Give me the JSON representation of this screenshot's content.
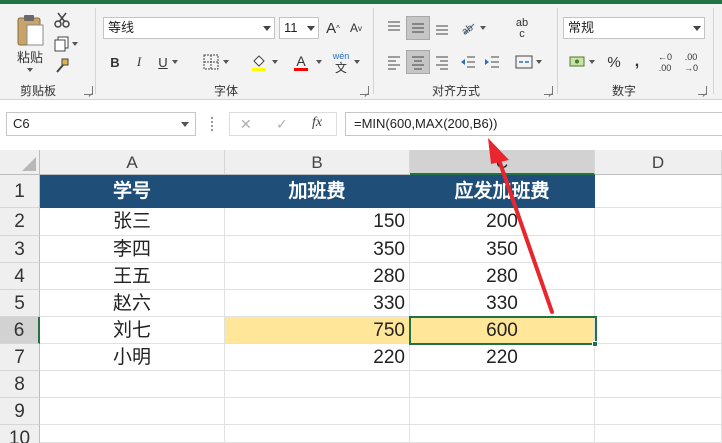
{
  "ribbon": {
    "clipboard": {
      "paste_label": "粘贴",
      "group_label": "剪贴板"
    },
    "font": {
      "font_name": "等线",
      "font_size": "11",
      "bold": "B",
      "italic": "I",
      "underline": "U",
      "grow": "A",
      "shrink": "A",
      "font_color": "A",
      "phonetic": "wén",
      "phonetic_sub": "文",
      "group_label": "字体"
    },
    "alignment": {
      "wrap": "ab",
      "wrap_sub": "c",
      "group_label": "对齐方式"
    },
    "number": {
      "format": "常规",
      "percent": "%",
      "comma": ",",
      "inc_decimal_top": "←0",
      "inc_decimal_bottom": ".00",
      "dec_decimal_top": ".00",
      "dec_decimal_bottom": "→0",
      "group_label": "数字"
    }
  },
  "formula_bar": {
    "name_box": "C6",
    "cancel": "✕",
    "enter": "✓",
    "fx": "fx",
    "formula": "=MIN(600,MAX(200,B6))"
  },
  "columns": [
    "A",
    "B",
    "C",
    "D"
  ],
  "rows": [
    "1",
    "2",
    "3",
    "4",
    "5",
    "6",
    "7",
    "8",
    "9",
    "10"
  ],
  "table": {
    "headers": [
      "学号",
      "加班费",
      "应发加班费"
    ],
    "rows": [
      [
        "张三",
        "150",
        "200"
      ],
      [
        "李四",
        "350",
        "350"
      ],
      [
        "王五",
        "280",
        "280"
      ],
      [
        "赵六",
        "330",
        "330"
      ],
      [
        "刘七",
        "750",
        "600"
      ],
      [
        "小明",
        "220",
        "220"
      ]
    ]
  },
  "active_cell": "C6",
  "colors": {
    "header_fill": "#1f4e79",
    "highlight": "#ffe699",
    "accent": "#217346",
    "annotation_arrow": "#e8262b"
  }
}
